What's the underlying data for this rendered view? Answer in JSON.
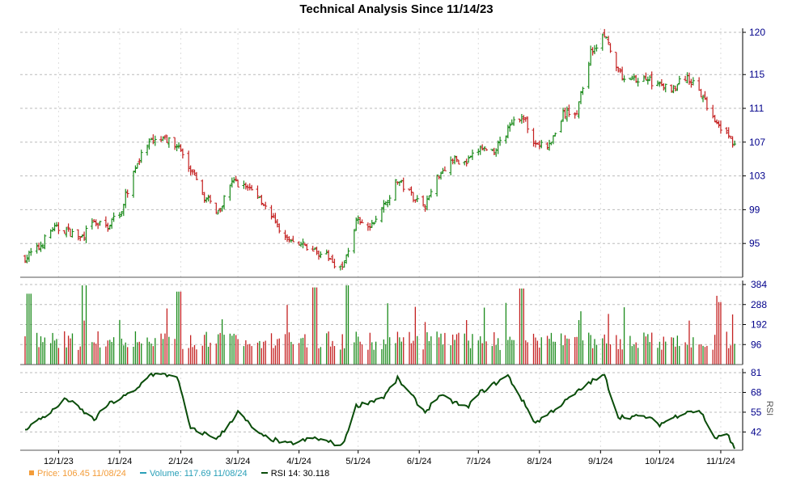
{
  "chart_data": {
    "type": "line",
    "title": "Technical Analysis Since 11/14/23",
    "x_ticks": [
      "12/1/23",
      "1/1/24",
      "2/1/24",
      "3/1/24",
      "4/1/24",
      "5/1/24",
      "6/1/24",
      "7/1/24",
      "8/1/24",
      "9/1/24",
      "10/1/24",
      "11/1/24"
    ],
    "price_panel": {
      "type": "ohlc",
      "ylim": [
        91,
        120
      ],
      "yticks": [
        95,
        99,
        103,
        107,
        111,
        115,
        120
      ],
      "series": [
        {
          "date": "11/14/23",
          "close": 93.3
        },
        {
          "date": "11/21/23",
          "close": 94.5
        },
        {
          "date": "11/28/23",
          "close": 96.8
        },
        {
          "date": "12/5/23",
          "close": 96.6
        },
        {
          "date": "12/12/23",
          "close": 95.6
        },
        {
          "date": "12/19/23",
          "close": 97.4
        },
        {
          "date": "12/26/23",
          "close": 97.0
        },
        {
          "date": "1/2/24",
          "close": 99.2
        },
        {
          "date": "1/9/24",
          "close": 104.2
        },
        {
          "date": "1/16/24",
          "close": 106.8
        },
        {
          "date": "1/23/24",
          "close": 107.3
        },
        {
          "date": "1/30/24",
          "close": 106.8
        },
        {
          "date": "2/6/24",
          "close": 103.5
        },
        {
          "date": "2/13/24",
          "close": 100.5
        },
        {
          "date": "2/20/24",
          "close": 98.8
        },
        {
          "date": "2/27/24",
          "close": 102.4
        },
        {
          "date": "3/5/24",
          "close": 101.8
        },
        {
          "date": "3/12/24",
          "close": 100.6
        },
        {
          "date": "3/19/24",
          "close": 97.6
        },
        {
          "date": "3/26/24",
          "close": 95.4
        },
        {
          "date": "4/2/24",
          "close": 94.8
        },
        {
          "date": "4/9/24",
          "close": 94.2
        },
        {
          "date": "4/16/24",
          "close": 93.3
        },
        {
          "date": "4/23/24",
          "close": 92.0
        },
        {
          "date": "4/30/24",
          "close": 97.5
        },
        {
          "date": "5/7/24",
          "close": 96.8
        },
        {
          "date": "5/14/24",
          "close": 99.5
        },
        {
          "date": "5/21/24",
          "close": 102.5
        },
        {
          "date": "5/28/24",
          "close": 100.8
        },
        {
          "date": "6/4/24",
          "close": 99.5
        },
        {
          "date": "6/11/24",
          "close": 103.3
        },
        {
          "date": "6/18/24",
          "close": 105.0
        },
        {
          "date": "6/25/24",
          "close": 104.5
        },
        {
          "date": "7/2/24",
          "close": 106.3
        },
        {
          "date": "7/9/24",
          "close": 106.0
        },
        {
          "date": "7/16/24",
          "close": 108.4
        },
        {
          "date": "7/23/24",
          "close": 110.3
        },
        {
          "date": "7/30/24",
          "close": 106.8
        },
        {
          "date": "8/6/24",
          "close": 106.5
        },
        {
          "date": "8/13/24",
          "close": 110.2
        },
        {
          "date": "8/20/24",
          "close": 110.6
        },
        {
          "date": "8/27/24",
          "close": 117.6
        },
        {
          "date": "9/3/24",
          "close": 119.7
        },
        {
          "date": "9/10/24",
          "close": 115.0
        },
        {
          "date": "9/17/24",
          "close": 114.3
        },
        {
          "date": "9/24/24",
          "close": 114.6
        },
        {
          "date": "10/1/24",
          "close": 113.6
        },
        {
          "date": "10/8/24",
          "close": 113.5
        },
        {
          "date": "10/15/24",
          "close": 114.8
        },
        {
          "date": "10/22/24",
          "close": 112.5
        },
        {
          "date": "10/29/24",
          "close": 109.8
        },
        {
          "date": "11/5/24",
          "close": 107.6
        },
        {
          "date": "11/8/24",
          "close": 106.45
        }
      ]
    },
    "volume_panel": {
      "ylim": [
        0,
        384
      ],
      "yticks": [
        96,
        192,
        288,
        384
      ],
      "peaks": [
        {
          "date": "11/16/23",
          "value": 340
        },
        {
          "date": "12/14/23",
          "value": 380
        },
        {
          "date": "1/31/24",
          "value": 350
        },
        {
          "date": "4/9/24",
          "value": 370
        },
        {
          "date": "4/26/24",
          "value": 380
        },
        {
          "date": "7/23/24",
          "value": 365
        },
        {
          "date": "10/31/24",
          "value": 330
        },
        {
          "date": "11/1/24",
          "value": 300
        }
      ]
    },
    "rsi_panel": {
      "label": "RSI",
      "ylim": [
        30,
        81
      ],
      "yticks": [
        42,
        55,
        68,
        81
      ],
      "series": [
        {
          "date": "11/14/23",
          "value": 44
        },
        {
          "date": "11/28/23",
          "value": 56
        },
        {
          "date": "12/5/23",
          "value": 64
        },
        {
          "date": "12/19/23",
          "value": 50
        },
        {
          "date": "12/26/23",
          "value": 60
        },
        {
          "date": "1/9/24",
          "value": 69
        },
        {
          "date": "1/16/24",
          "value": 80
        },
        {
          "date": "1/30/24",
          "value": 79
        },
        {
          "date": "2/6/24",
          "value": 44
        },
        {
          "date": "2/20/24",
          "value": 38
        },
        {
          "date": "3/1/24",
          "value": 55
        },
        {
          "date": "3/12/24",
          "value": 40
        },
        {
          "date": "3/26/24",
          "value": 34
        },
        {
          "date": "4/9/24",
          "value": 38
        },
        {
          "date": "4/23/24",
          "value": 33
        },
        {
          "date": "4/30/24",
          "value": 59
        },
        {
          "date": "5/14/24",
          "value": 65
        },
        {
          "date": "5/21/24",
          "value": 77
        },
        {
          "date": "6/4/24",
          "value": 55
        },
        {
          "date": "6/11/24",
          "value": 66
        },
        {
          "date": "6/25/24",
          "value": 58
        },
        {
          "date": "7/2/24",
          "value": 68
        },
        {
          "date": "7/16/24",
          "value": 79
        },
        {
          "date": "7/30/24",
          "value": 48
        },
        {
          "date": "8/13/24",
          "value": 61
        },
        {
          "date": "8/27/24",
          "value": 75
        },
        {
          "date": "9/3/24",
          "value": 79
        },
        {
          "date": "9/10/24",
          "value": 52
        },
        {
          "date": "9/24/24",
          "value": 52
        },
        {
          "date": "10/1/24",
          "value": 47
        },
        {
          "date": "10/15/24",
          "value": 56
        },
        {
          "date": "10/22/24",
          "value": 55
        },
        {
          "date": "10/29/24",
          "value": 38
        },
        {
          "date": "11/5/24",
          "value": 40
        },
        {
          "date": "11/8/24",
          "value": 30.118
        }
      ]
    }
  },
  "legend": {
    "price": "Price: 106.45  11/08/24",
    "volume": "Volume: 117.69  11/08/24",
    "rsi": "RSI 14: 30.118"
  },
  "colors": {
    "up": "#1a8a1a",
    "down": "#c42020",
    "rsi_line": "#0a4d0a",
    "axis": "#000080",
    "grid": "#bbbbbb"
  }
}
